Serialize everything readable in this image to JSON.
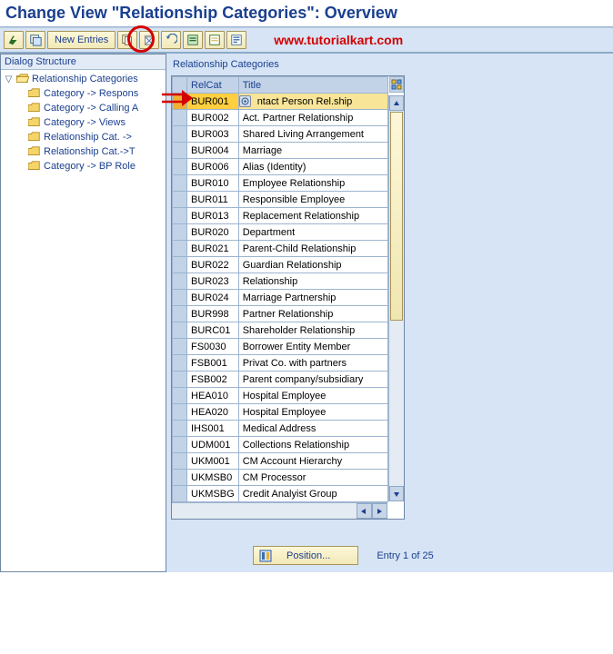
{
  "title": "Change View \"Relationship Categories\": Overview",
  "watermark": "www.tutorialkart.com",
  "toolbar": {
    "new_entries": "New Entries"
  },
  "tree": {
    "header": "Dialog Structure",
    "root": "Relationship Categories",
    "children": [
      "Category -> Respons",
      "Category -> Calling A",
      "Category -> Views",
      "Relationship Cat. ->",
      "Relationship Cat.->T",
      "Category -> BP Role"
    ]
  },
  "panel": {
    "title": "Relationship Categories",
    "col_relcat": "RelCat",
    "col_title": "Title",
    "rows": [
      {
        "relcat": "BUR001",
        "title": "ntact Person Rel.ship",
        "selected": true,
        "detail": true
      },
      {
        "relcat": "BUR002",
        "title": "Act. Partner Relationship"
      },
      {
        "relcat": "BUR003",
        "title": "Shared Living Arrangement"
      },
      {
        "relcat": "BUR004",
        "title": "Marriage"
      },
      {
        "relcat": "BUR006",
        "title": "Alias (Identity)"
      },
      {
        "relcat": "BUR010",
        "title": "Employee Relationship"
      },
      {
        "relcat": "BUR011",
        "title": "Responsible Employee"
      },
      {
        "relcat": "BUR013",
        "title": "Replacement Relationship"
      },
      {
        "relcat": "BUR020",
        "title": "Department"
      },
      {
        "relcat": "BUR021",
        "title": "Parent-Child Relationship"
      },
      {
        "relcat": "BUR022",
        "title": "Guardian Relationship"
      },
      {
        "relcat": "BUR023",
        "title": "Relationship"
      },
      {
        "relcat": "BUR024",
        "title": "Marriage Partnership"
      },
      {
        "relcat": "BUR998",
        "title": "Partner Relationship"
      },
      {
        "relcat": "BURC01",
        "title": "Shareholder Relationship"
      },
      {
        "relcat": "FS0030",
        "title": "Borrower Entity Member"
      },
      {
        "relcat": "FSB001",
        "title": "Privat Co. with partners"
      },
      {
        "relcat": "FSB002",
        "title": "Parent company/subsidiary"
      },
      {
        "relcat": "HEA010",
        "title": "Hospital Employee"
      },
      {
        "relcat": "HEA020",
        "title": "Hospital Employee"
      },
      {
        "relcat": "IHS001",
        "title": "Medical Address"
      },
      {
        "relcat": "UDM001",
        "title": "Collections Relationship"
      },
      {
        "relcat": "UKM001",
        "title": "CM Account Hierarchy"
      },
      {
        "relcat": "UKMSB0",
        "title": "CM Processor"
      },
      {
        "relcat": "UKMSBG",
        "title": "Credit Analyist Group"
      }
    ]
  },
  "position_label": "Position...",
  "entry_text": "Entry 1 of 25"
}
